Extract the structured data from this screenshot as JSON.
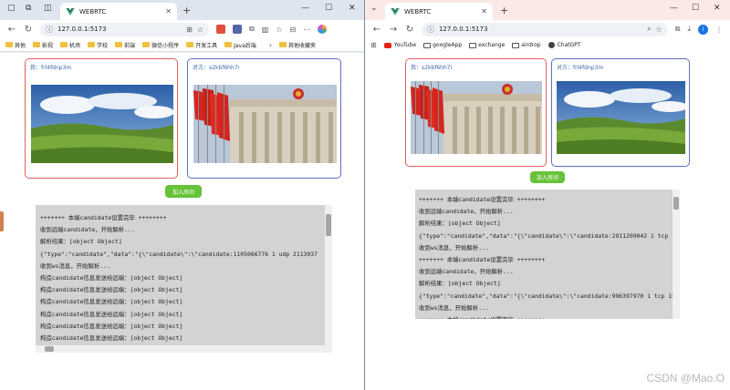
{
  "left": {
    "tab_title": "WEBRTC",
    "url": "127.0.0.1:5173",
    "bookmarks": [
      "其他",
      "影视",
      "机场",
      "学校",
      "前端",
      "微信小程序",
      "开发工具",
      "Java后端"
    ],
    "other_bookmarks": "其他收藏夹",
    "local_label": "我：frl4fdnp3m",
    "remote_label": "对方：s2kbf6hh7i",
    "join_label": "加入房间",
    "log": [
      "+++++++ 本端candidate设置完毕 ++++++++",
      "收到远端candidate，开始解析...",
      "解析结果：[object Object]",
      "{\"type\":\"candidate\",\"data\":\"{\\\"candidate\\\":\\\"candidate:1105066776 1 udp 2113937",
      "收到ws消息，开始解析...",
      "构造candidate信息发送给远端：[object Object]",
      "构造candidate信息发送给远端：[object Object]",
      "构造candidate信息发送给远端：[object Object]",
      "构造candidate信息发送给远端：[object Object]",
      "构造candidate信息发送给远端：[object Object]",
      "构造candidate信息发送给远端：[object Object]"
    ]
  },
  "right": {
    "tab_title": "WEBRTC",
    "url": "127.0.0.1:5173",
    "bookmarks": [
      "YouTube",
      "googleApp",
      "exchange",
      "airdrop",
      "ChatGPT"
    ],
    "local_label": "我：s2kbf6hh7i",
    "remote_label": "对方：frl4fdnp3m",
    "join_label": "加入房间",
    "log": [
      "+++++++ 本端candidate设置完毕 ++++++++",
      "收到远端candidate，开始解析...",
      "解析结果：[object Object]",
      "{\"type\":\"candidate\",\"data\":\"{\\\"candidate\\\":\\\"candidate:2911209042 1 tcp 15",
      "收到ws消息，开始解析...",
      "+++++++ 本端candidate设置完毕 ++++++++",
      "收到远端candidate，开始解析...",
      "解析结果：[object Object]",
      "{\"type\":\"candidate\",\"data\":\"{\\\"candidate\\\":\\\"candidate:996397970 1 tcp 151",
      "收到ws消息，开始解析...",
      "+++++++ 本端candidate设置完毕 ++++++++"
    ]
  },
  "watermark": "CSDN @Mao.O",
  "colors": {
    "local_border": "#e06060",
    "remote_border": "#5a6fc0",
    "join_button": "#67c23a",
    "log_bg": "#d3d3d3"
  },
  "icons": [
    "sidebar-icon",
    "tabs-icon",
    "back-icon",
    "forward-icon",
    "reload-icon",
    "star-icon",
    "extensions-icon",
    "profile-icon",
    "more-icon",
    "apps-icon",
    "download-icon"
  ]
}
